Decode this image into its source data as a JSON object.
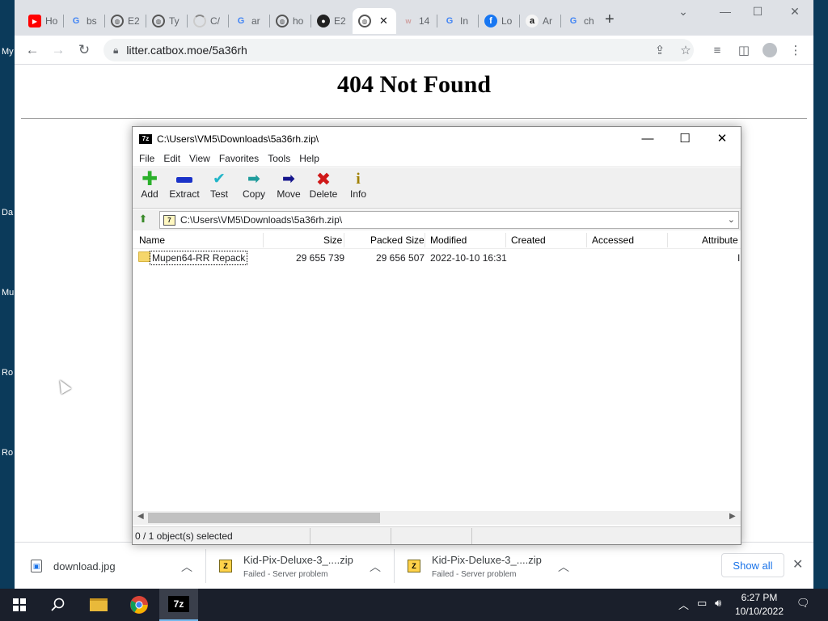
{
  "desktop": {
    "labels": [
      "My",
      "Da",
      "Mu",
      "Ro",
      "Ro"
    ]
  },
  "browser": {
    "tabs": [
      {
        "label": "Ho",
        "icon": "youtube-icon"
      },
      {
        "label": "bs",
        "icon": "google-icon"
      },
      {
        "label": "E2",
        "icon": "globe-icon"
      },
      {
        "label": "Ty",
        "icon": "globe-icon"
      },
      {
        "label": "C/",
        "icon": "loading-icon"
      },
      {
        "label": "ar",
        "icon": "google-icon"
      },
      {
        "label": "ho",
        "icon": "globe-icon"
      },
      {
        "label": "E2",
        "icon": "github-icon"
      },
      {
        "label": "",
        "icon": "globe-icon",
        "active": true
      },
      {
        "label": "14",
        "icon": "page-icon"
      },
      {
        "label": "In",
        "icon": "google-icon"
      },
      {
        "label": "Lo",
        "icon": "facebook-icon"
      },
      {
        "label": "Ar",
        "icon": "amazon-icon"
      },
      {
        "label": "ch",
        "icon": "google-icon"
      }
    ],
    "new_tab": "+",
    "url": "litter.catbox.moe/5a36rh"
  },
  "page": {
    "heading": "404 Not Found"
  },
  "sevenzip": {
    "title": "C:\\Users\\VM5\\Downloads\\5a36rh.zip\\",
    "menu": [
      "File",
      "Edit",
      "View",
      "Favorites",
      "Tools",
      "Help"
    ],
    "toolbar": [
      {
        "label": "Add",
        "icon": "add-icon"
      },
      {
        "label": "Extract",
        "icon": "extract-icon"
      },
      {
        "label": "Test",
        "icon": "test-icon"
      },
      {
        "label": "Copy",
        "icon": "copy-icon"
      },
      {
        "label": "Move",
        "icon": "move-icon"
      },
      {
        "label": "Delete",
        "icon": "delete-icon"
      },
      {
        "label": "Info",
        "icon": "info-icon"
      }
    ],
    "path": "C:\\Users\\VM5\\Downloads\\5a36rh.zip\\",
    "columns": [
      "Name",
      "Size",
      "Packed Size",
      "Modified",
      "Created",
      "Accessed",
      "Attribute"
    ],
    "rows": [
      {
        "name": "Mupen64-RR Repack",
        "size": "29 655 739",
        "packed": "29 656 507",
        "modified": "2022-10-10 16:31",
        "attr": "I"
      }
    ],
    "status": "0 / 1 object(s) selected"
  },
  "downloads": {
    "items": [
      {
        "name": "download.jpg",
        "sub": ""
      },
      {
        "name": "Kid-Pix-Deluxe-3_....zip",
        "sub": "Failed - Server problem"
      },
      {
        "name": "Kid-Pix-Deluxe-3_....zip",
        "sub": "Failed - Server problem"
      }
    ],
    "show_all": "Show all"
  },
  "taskbar": {
    "time": "6:27 PM",
    "date": "10/10/2022"
  },
  "colors": {
    "accent": "#1a73e8",
    "taskbar": "#1a1f2b"
  }
}
